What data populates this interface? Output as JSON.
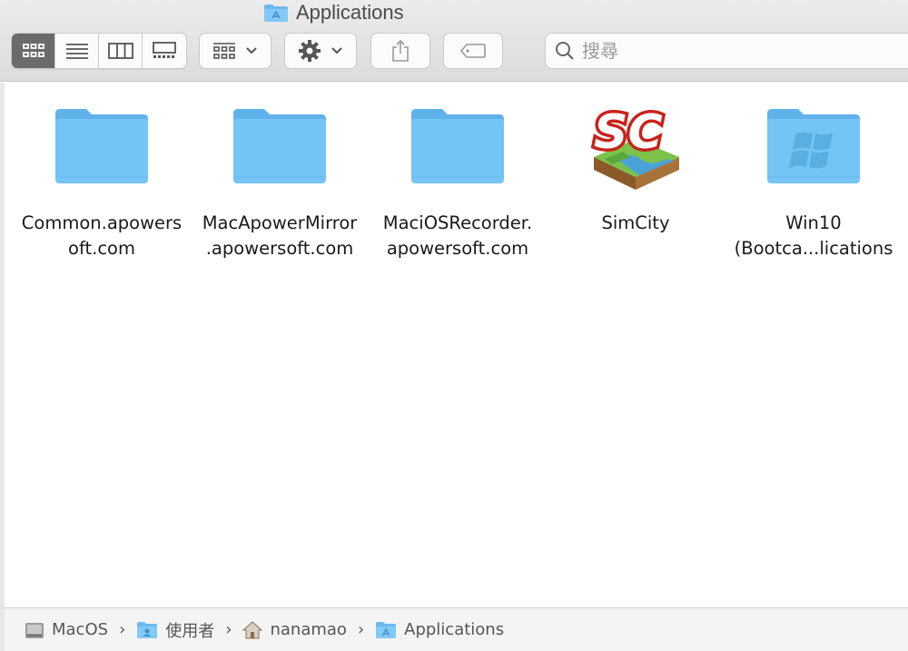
{
  "window": {
    "title": "Applications"
  },
  "toolbar": {
    "view_modes": [
      {
        "name": "icon-view",
        "active": true
      },
      {
        "name": "list-view",
        "active": false
      },
      {
        "name": "column-view",
        "active": false
      },
      {
        "name": "gallery-view",
        "active": false
      }
    ],
    "group_icon": "group-by-icon",
    "action_icon": "gear-icon",
    "share_icon": "share-icon",
    "tag_icon": "tag-icon",
    "search_placeholder": "搜尋"
  },
  "items": [
    {
      "label_line1": "Common.apowers",
      "label_line2": "oft.com",
      "icon": "folder-icon"
    },
    {
      "label_line1": "MacApowerMirror",
      "label_line2": ".apowersoft.com",
      "icon": "folder-icon"
    },
    {
      "label_line1": "MaciOSRecorder.",
      "label_line2": "apowersoft.com",
      "icon": "folder-icon"
    },
    {
      "label_line1": "SimCity",
      "label_line2": "",
      "icon": "simcity-app-icon",
      "logo_text": "SC"
    },
    {
      "label_line1": "Win10",
      "label_line2": "(Bootca...lications",
      "icon": "windows-folder-icon"
    }
  ],
  "pathbar": {
    "crumbs": [
      {
        "label": "MacOS",
        "icon": "hard-drive-icon"
      },
      {
        "label": "使用者",
        "icon": "users-folder-icon"
      },
      {
        "label": "nanamao",
        "icon": "home-icon"
      },
      {
        "label": "Applications",
        "icon": "applications-folder-icon"
      }
    ],
    "separator": "›"
  },
  "colors": {
    "folder": "#6cc4f5",
    "folder_tab": "#5fb6ea",
    "active_view": "#6b6b6b"
  }
}
